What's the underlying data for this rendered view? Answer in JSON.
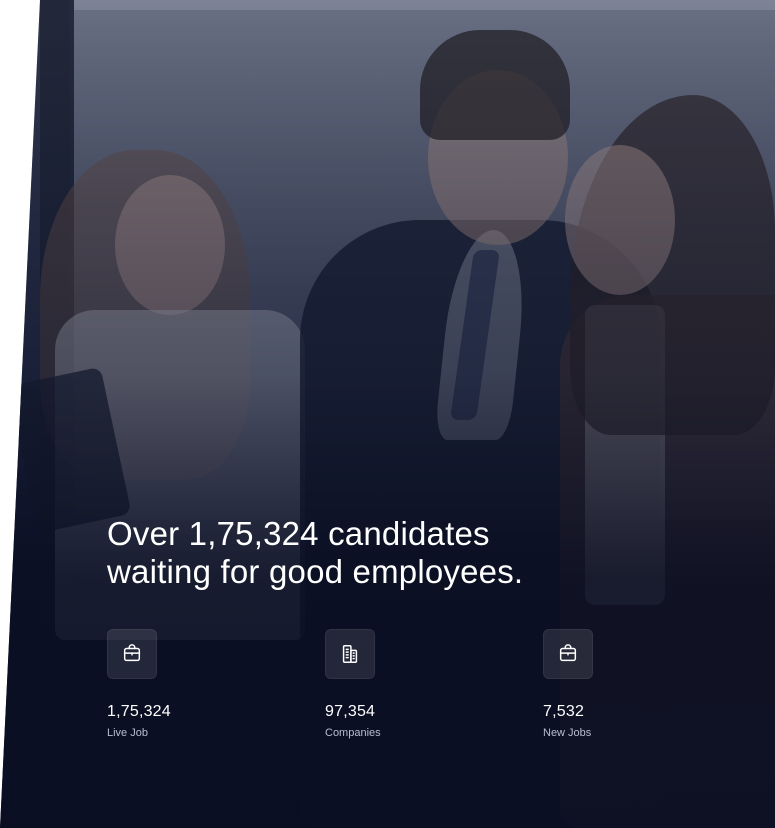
{
  "hero": {
    "headline": "Over 1,75,324 candidates\nwaiting for good employees."
  },
  "stats": [
    {
      "icon": "briefcase-icon",
      "value": "1,75,324",
      "label": "Live Job"
    },
    {
      "icon": "building-icon",
      "value": "97,354",
      "label": "Companies"
    },
    {
      "icon": "briefcase-icon",
      "value": "7,532",
      "label": "New Jobs"
    }
  ],
  "colors": {
    "text_primary": "#ffffff",
    "text_secondary": "#d6dcec",
    "overlay_dark": "#0a0e22"
  }
}
